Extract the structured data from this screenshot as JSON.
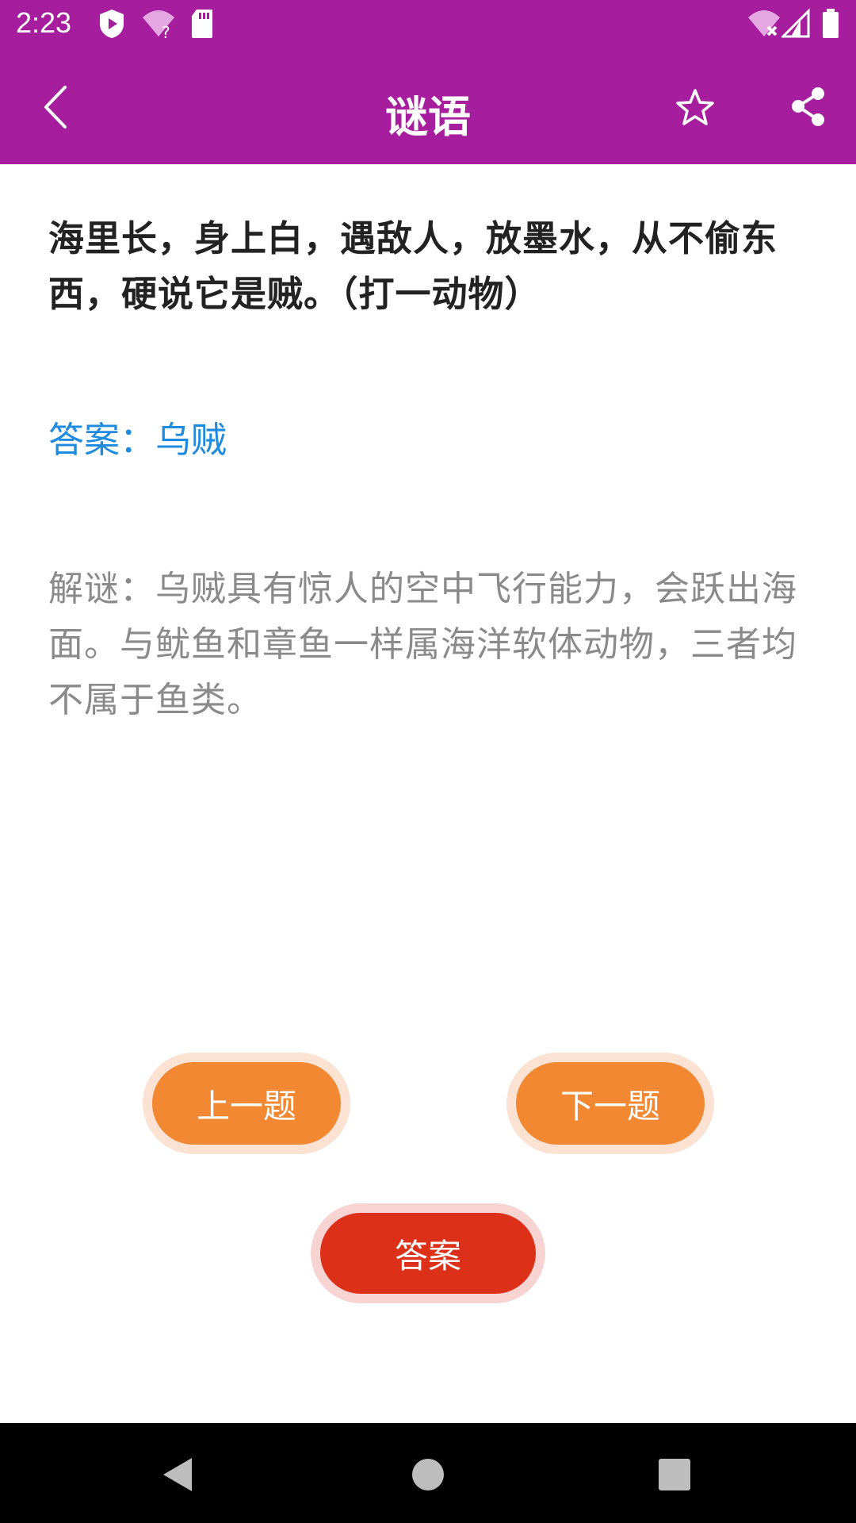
{
  "status_bar": {
    "time": "2:23",
    "icons": [
      "play-protect-icon",
      "wifi-question-icon",
      "sd-card-icon",
      "wifi-off-icon",
      "signal-icon",
      "battery-icon"
    ]
  },
  "app_bar": {
    "title": "谜语",
    "back_icon": "chevron-left-icon",
    "favorite_icon": "star-outline-icon",
    "share_icon": "share-icon",
    "background": "#A61E9E"
  },
  "content": {
    "question": "海里长，身上白，遇敌人，放墨水，从不偷东西，硬说它是贼。（打一动物）",
    "answer": "答案：乌贼",
    "explanation": "解谜：乌贼具有惊人的空中飞行能力，会跃出海面。与鱿鱼和章鱼一样属海洋软体动物，三者均不属于鱼类。"
  },
  "buttons": {
    "prev": "上一题",
    "next": "下一题",
    "answer": "答案"
  },
  "colors": {
    "accent_blue": "#1E8BE0",
    "orange": "#F28832",
    "red": "#DD3019"
  },
  "nav_bar": {
    "back": "triangle-back-icon",
    "home": "circle-home-icon",
    "recents": "square-recents-icon"
  }
}
